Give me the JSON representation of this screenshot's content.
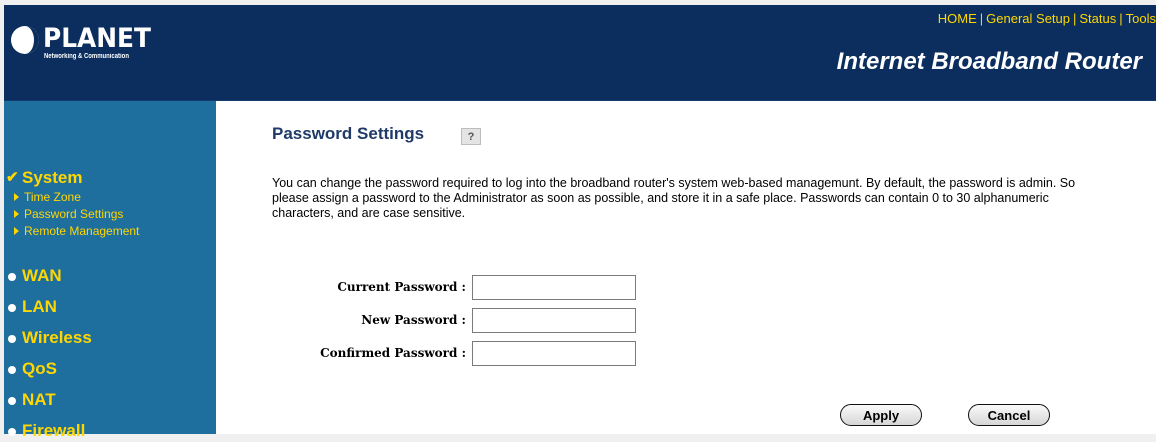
{
  "header": {
    "logo_text": "PLANET",
    "logo_tagline": "Networking & Communication",
    "product_title": "Internet Broadband Router",
    "nav": [
      "HOME",
      "General Setup",
      "Status",
      "Tools"
    ],
    "colors": {
      "header_bg": "#0b2e5e",
      "nav_text": "#ffd700",
      "sidebar_bg": "#1e6e9e"
    }
  },
  "sidebar": {
    "system": {
      "label": "System",
      "icon": "check-icon",
      "items": [
        "Time Zone",
        "Password Settings",
        "Remote Management"
      ]
    },
    "items": [
      "WAN",
      "LAN",
      "Wireless",
      "QoS",
      "NAT",
      "Firewall"
    ]
  },
  "main": {
    "title": "Password Settings",
    "help_icon_label": "?",
    "description": "You can change the password required to log into the broadband router's system web-based managemunt. By default, the password is admin. So please assign a password to the Administrator as soon as possible, and store it in a safe place. Passwords can contain 0 to 30 alphanumeric characters, and are case sensitive.",
    "form": {
      "current_label": "Current Password :",
      "new_label": "New Password :",
      "confirm_label": "Confirmed Password :",
      "current_value": "",
      "new_value": "",
      "confirm_value": ""
    },
    "buttons": {
      "apply": "Apply",
      "cancel": "Cancel"
    }
  }
}
